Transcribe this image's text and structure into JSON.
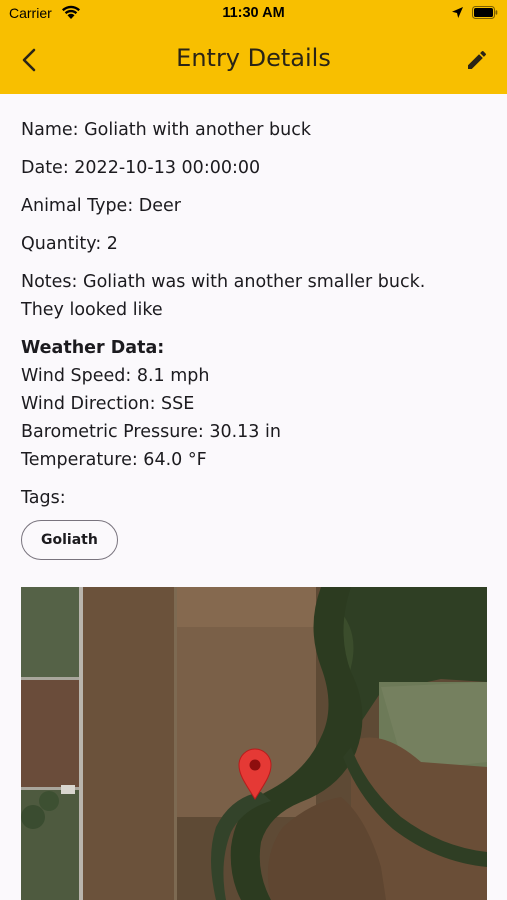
{
  "status_bar": {
    "carrier": "Carrier",
    "time": "11:30 AM"
  },
  "header": {
    "title": "Entry Details",
    "back_icon": "chevron-left-icon",
    "edit_icon": "pencil-icon",
    "background_color": "#f8bf00"
  },
  "entry": {
    "name": "Name: Goliath with another buck",
    "date": "Date: 2022-10-13 00:00:00",
    "animal_type": "Animal Type: Deer",
    "quantity": "Quantity: 2",
    "notes_line1": "Notes: Goliath was with another smaller buck.",
    "notes_line2": "They looked like"
  },
  "weather": {
    "heading": "Weather Data:",
    "wind_speed": "Wind Speed: 8.1 mph",
    "wind_direction": "Wind Direction: SSE",
    "pressure": "Barometric Pressure: 30.13 in",
    "temperature": "Temperature: 64.0 °F"
  },
  "tags": {
    "label": "Tags:",
    "items": [
      "Goliath"
    ]
  },
  "map": {
    "marker_icon": "map-pin-icon",
    "marker_color": "#e53935",
    "style": "satellite"
  }
}
